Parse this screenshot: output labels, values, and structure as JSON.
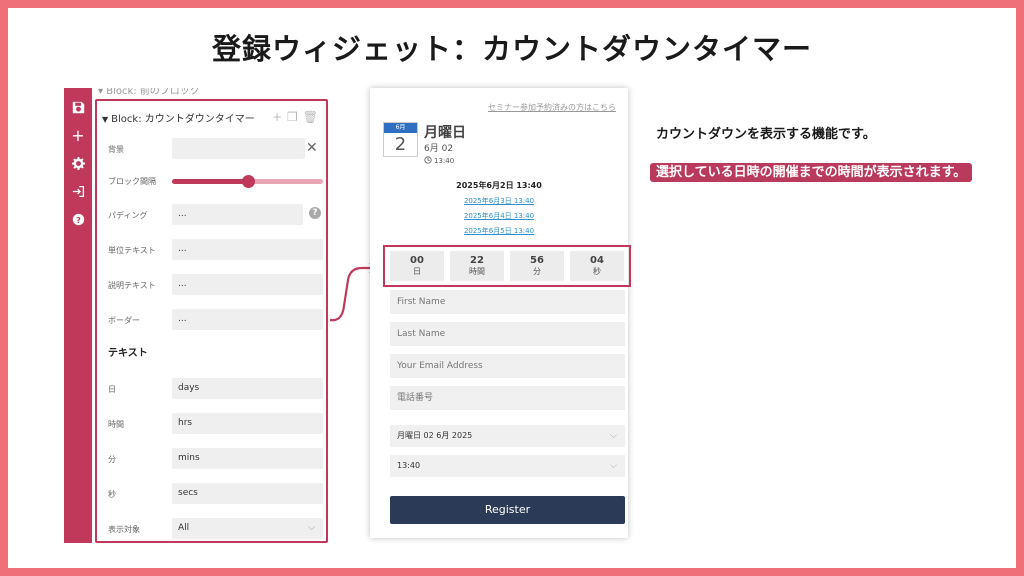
{
  "title": "登録ウィジェット：カウントダウンタイマー",
  "editor": {
    "prev_block_label": "▾ Block: 前のブロック",
    "block_label": "Block: カウントダウンタイマー",
    "fields": [
      {
        "label": "背景",
        "value": ""
      },
      {
        "label": "ブロック間隔",
        "value": ""
      },
      {
        "label": "パディング",
        "value": "..."
      },
      {
        "label": "単位テキスト",
        "value": "..."
      },
      {
        "label": "説明テキスト",
        "value": "..."
      },
      {
        "label": "ボーダー",
        "value": "..."
      }
    ],
    "slider_fraction": 0.5,
    "text_section": "テキスト",
    "text_fields": [
      {
        "label": "日",
        "value": "days"
      },
      {
        "label": "時間",
        "value": "hrs"
      },
      {
        "label": "分",
        "value": "mins"
      },
      {
        "label": "秒",
        "value": "secs"
      }
    ],
    "display_target": {
      "label": "表示対象",
      "value": "All"
    }
  },
  "preview": {
    "seminar_link": "セミナー参加予約済みの方はこちら",
    "calendar": {
      "month": "6月",
      "day": "2"
    },
    "day_name": "月曜日",
    "day_date": "6月 02",
    "day_time": "13:40",
    "schedule_main": "2025年6月2日 13:40",
    "schedule_links": [
      "2025年6月3日 13:40",
      "2025年6月4日 13:40",
      "2025年6月5日 13:40"
    ],
    "countdown": [
      {
        "value": "00",
        "unit": "日"
      },
      {
        "value": "22",
        "unit": "時間"
      },
      {
        "value": "56",
        "unit": "分"
      },
      {
        "value": "04",
        "unit": "秒"
      }
    ],
    "inputs": {
      "first_name": "First Name",
      "last_name": "Last Name",
      "email": "Your Email Address",
      "phone": "電話番号"
    },
    "date_select": "月曜日 02 6月 2025",
    "time_select": "13:40",
    "register_label": "Register"
  },
  "description": {
    "line1": "カウントダウンを表示する機能です。",
    "line2": "選択している日時の開催までの時間が表示されます。"
  },
  "colors": {
    "accent": "#c0385a",
    "border": "#f0707a",
    "button": "#2b3a56",
    "link": "#2e8fd0"
  }
}
